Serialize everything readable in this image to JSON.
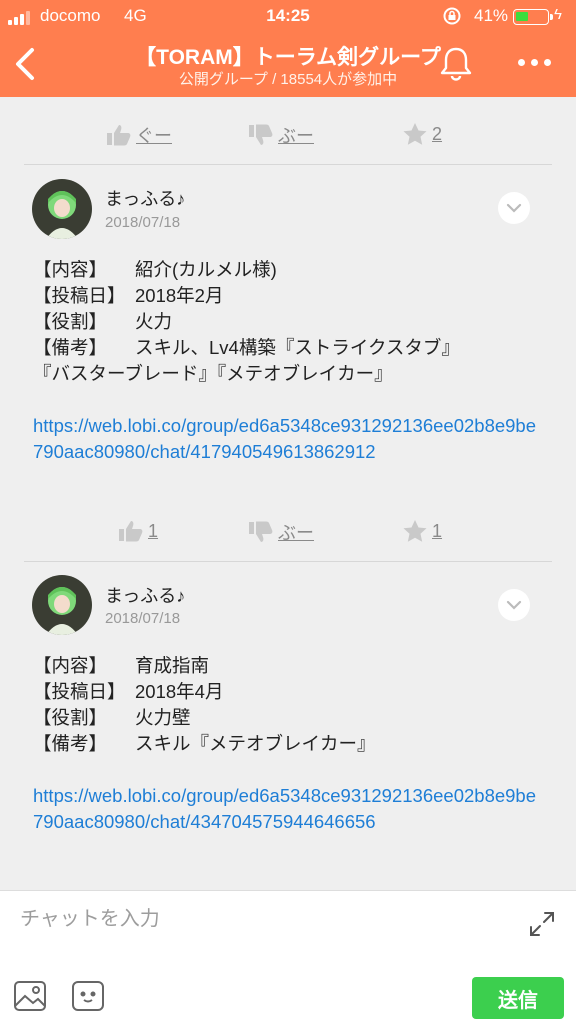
{
  "status": {
    "carrier": "docomo",
    "network": "4G",
    "time": "14:25",
    "battery": "41%",
    "battery_level": 0.41
  },
  "header": {
    "title": "【TORAM】トーラム剣グループ",
    "subtitle": "公開グループ / 18554人が参加中"
  },
  "top_actions": {
    "good": "ぐー",
    "boo": "ぶー",
    "star": "2"
  },
  "posts": [
    {
      "author": "まっふる♪",
      "date": "2018/07/18",
      "fields": [
        {
          "k": "【内容】",
          "v": "紹介(カルメル様)"
        },
        {
          "k": "【投稿日】",
          "v": "2018年2月"
        },
        {
          "k": "【役割】",
          "v": "火力"
        },
        {
          "k": "【備考】",
          "v": "スキル、Lv4構築『ストライクスタブ』"
        }
      ],
      "continuation": "『バスターブレード』『メテオブレイカー』",
      "link": "https://web.lobi.co/group/ed6a5348ce931292136ee02b8e9be790aac80980/chat/417940549613862912",
      "actions": {
        "good": "1",
        "boo": "ぶー",
        "star": "1"
      }
    },
    {
      "author": "まっふる♪",
      "date": "2018/07/18",
      "fields": [
        {
          "k": "【内容】",
          "v": "育成指南"
        },
        {
          "k": "【投稿日】",
          "v": "2018年4月"
        },
        {
          "k": "【役割】",
          "v": "火力壁"
        },
        {
          "k": "【備考】",
          "v": "スキル『メテオブレイカー』"
        }
      ],
      "link": "https://web.lobi.co/group/ed6a5348ce931292136ee02b8e9be790aac80980/chat/434704575944646656"
    }
  ],
  "composer": {
    "placeholder": "チャットを入力",
    "send_label": "送信"
  },
  "icons": [
    "back-icon",
    "bell-icon",
    "more-icon",
    "thumbs-up-icon",
    "thumbs-down-icon",
    "star-icon",
    "chevron-down-icon",
    "fullscreen-icon",
    "image-icon",
    "sticker-icon"
  ],
  "colors": {
    "header": "#ff7e4f",
    "link": "#1e7ed6",
    "send": "#3ccf4e"
  }
}
